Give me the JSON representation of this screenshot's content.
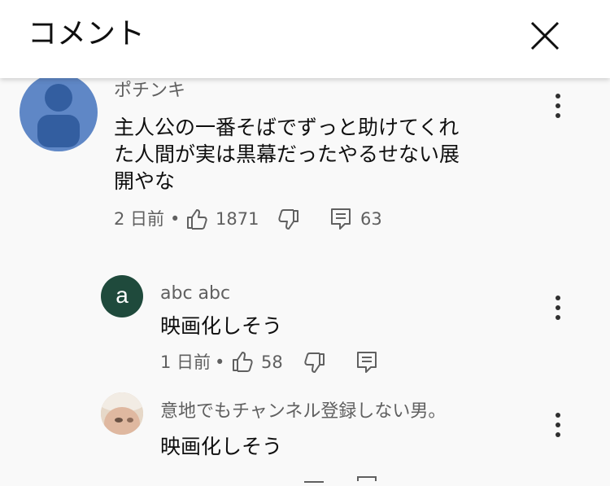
{
  "header": {
    "title": "コメント"
  },
  "comments": [
    {
      "author": "ポチンキ",
      "text": "主人公の一番そばでずっと助けてくれた人間が実は黒幕だったやるせない展開やな",
      "lines": [
        "主人公の一番そばでずっと助けてくれ",
        "た人間が実は黒幕だったやるせない展",
        "開やな"
      ],
      "time": "2 日前",
      "likes": "1871",
      "replies": "63"
    },
    {
      "author": "abc abc",
      "avatar_letter": "a",
      "text": "映画化しそう",
      "time": "1 日前",
      "likes": "58"
    },
    {
      "author": "意地でもチャンネル登録しない男。",
      "text": "映画化しそう"
    }
  ],
  "colors": {
    "header_bg": "#ffffff",
    "page_bg": "#f9f9f9",
    "secondary_text": "#606060",
    "avatar_blue": "#5f87c6",
    "avatar_green": "#1f4a3c"
  }
}
